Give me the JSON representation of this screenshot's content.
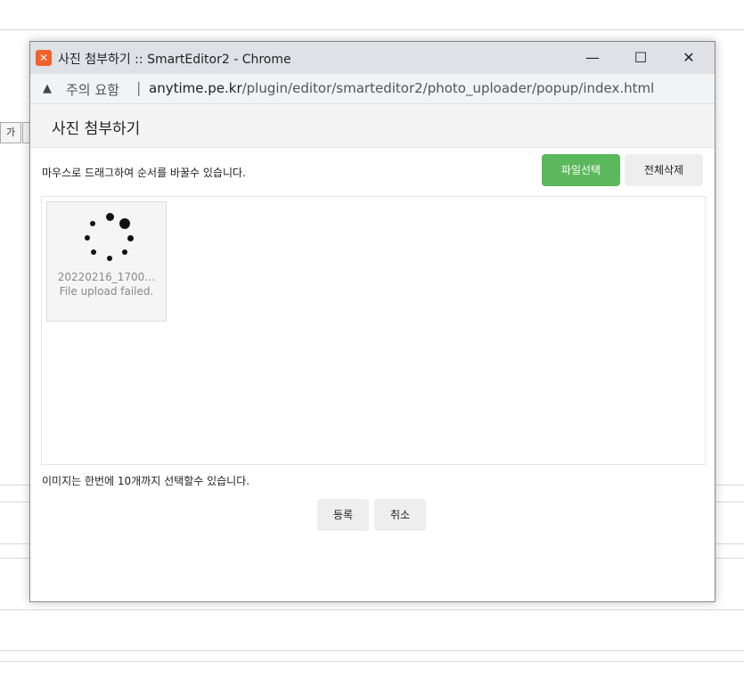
{
  "background": {
    "toolbar_glyph": "가"
  },
  "window": {
    "title": "사진 첨부하기 :: SmartEditor2 - Chrome",
    "icon": "xampp-app-icon",
    "controls": {
      "minimize": "—",
      "maximize": "☐",
      "close": "✕"
    }
  },
  "addressbar": {
    "warning_icon": "▲",
    "warning_text": "주의 요함",
    "separator": "|",
    "host": "anytime.pe.kr",
    "path": "/plugin/editor/smarteditor2/photo_uploader/popup/index.html"
  },
  "page": {
    "title": "사진 첨부하기",
    "hint_top": "마우스로 드래그하여 순서를 바꿀수 있습니다.",
    "select_button": "파일선택",
    "delete_all_button": "전체삭제",
    "files": [
      {
        "name": "20220216_1700…",
        "status": "File upload failed."
      }
    ],
    "hint_bottom": "이미지는 한번에 10개까지 선택할수 있습니다.",
    "submit_button": "등록",
    "cancel_button": "취소"
  },
  "colors": {
    "select_button_bg": "#5cb85c",
    "titlebar_bg": "#dee1e6"
  }
}
